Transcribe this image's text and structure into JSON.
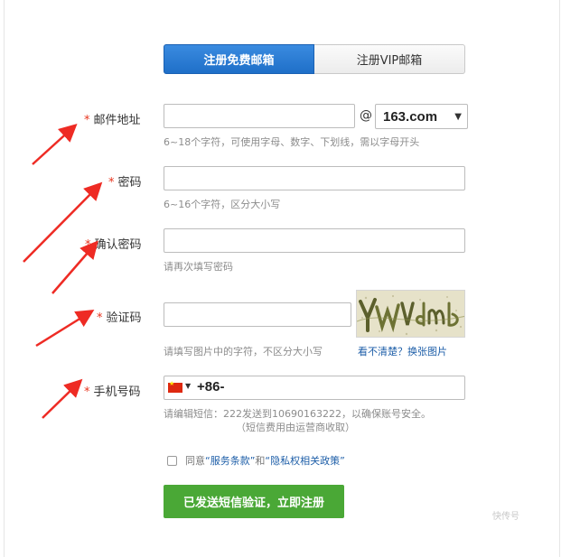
{
  "tabs": [
    {
      "label": "注册免费邮箱",
      "active": true
    },
    {
      "label": "注册VIP邮箱",
      "active": false
    }
  ],
  "required_mark": "*",
  "fields": {
    "email": {
      "label": "邮件地址",
      "value": "",
      "at": "@",
      "domain": "163.com",
      "hint": "6~18个字符，可使用字母、数字、下划线，需以字母开头"
    },
    "password": {
      "label": "密码",
      "value": "",
      "hint": "6~16个字符，区分大小写"
    },
    "confirm": {
      "label": "确认密码",
      "value": "",
      "hint": "请再次填写密码"
    },
    "captcha": {
      "label": "验证码",
      "value": "",
      "image_text": "YWVdmb",
      "hint": "请填写图片中的字符，不区分大小写",
      "refresh_link": "看不清楚？换张图片"
    },
    "phone": {
      "label": "手机号码",
      "country_code": "+86-",
      "hint_line1": "请编辑短信：222发送到10690163222，以确保账号安全。",
      "hint_line2": "（短信费用由运营商收取）"
    }
  },
  "agreement": {
    "prefix": "同意",
    "terms": "“服务条款”",
    "and": "和",
    "privacy": "“隐私权相关政策”"
  },
  "submit_label": "已发送短信验证，立即注册",
  "watermark": "快传号",
  "colors": {
    "primary": "#1f6fc8",
    "submit": "#4aa836",
    "required": "#e8341e",
    "annotation_arrow": "#ee2b24"
  }
}
